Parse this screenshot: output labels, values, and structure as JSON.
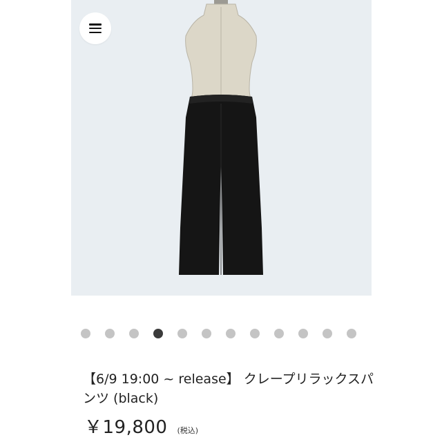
{
  "menu": {
    "icon": "hamburger-menu-icon"
  },
  "gallery": {
    "image_description_icon": "product-photo",
    "dot_count": 12,
    "active_index": 3
  },
  "product": {
    "title": "【6/9 19:00 ~ release】 クレープリラックスパンツ (black)",
    "price": "￥19,800",
    "tax_note": "(税込)"
  },
  "colors": {
    "image_background": "#e9eef2",
    "pants": "#151515",
    "mannequin": "#d9d4c4",
    "dot_inactive": "#c4c4c4",
    "dot_active": "#3b3b3b"
  }
}
